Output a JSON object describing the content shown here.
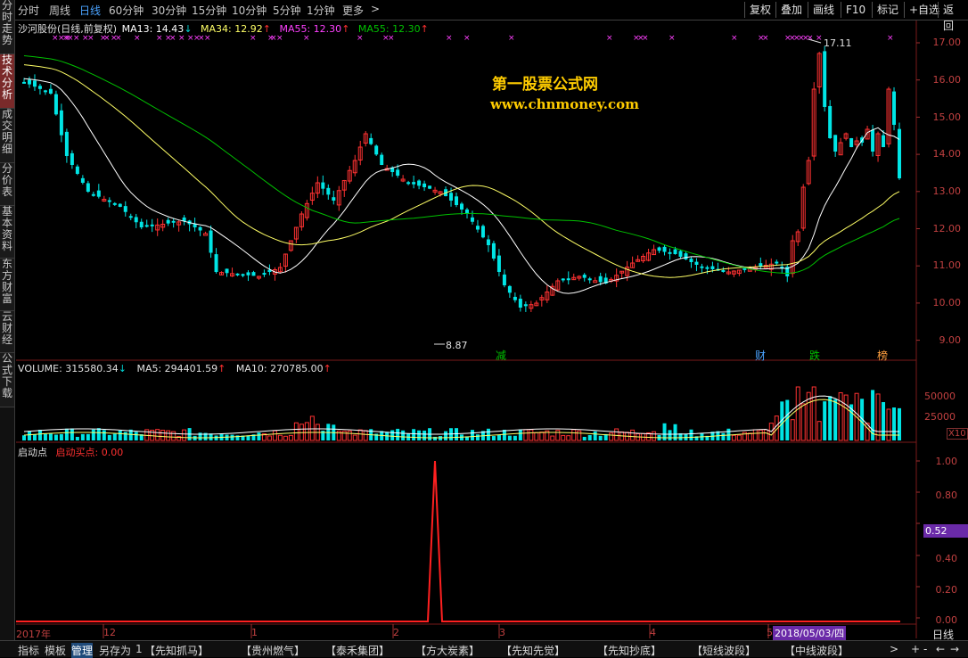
{
  "toolbar": {
    "periods": [
      "分时",
      "周线",
      "日线",
      "60分钟",
      "30分钟",
      "15分钟",
      "10分钟",
      "5分钟",
      "1分钟",
      "更多"
    ],
    "active_period": "日线",
    "more_arrow": ">",
    "right_buttons": [
      "复权",
      "叠加",
      "画线",
      "F10",
      "标记",
      "+自选",
      "返回"
    ]
  },
  "left_tabs": [
    "分时走势",
    "技术分析",
    "成交明细",
    "分价表",
    "基本资料",
    "东方财富",
    "云财经",
    "公式下载"
  ],
  "active_left_tab": "技术分析",
  "price_panel": {
    "title": "沙河股份(日线,前复权)",
    "ma13": "MA13: 14.43",
    "ma34": "MA34: 12.92",
    "ma55a": "MA55: 12.30",
    "ma55b": "MA55: 12.30",
    "ma13_dir": "↓",
    "ma34_dir": "↑",
    "ma55a_dir": "↑",
    "ma55b_dir": "↑",
    "watermark_title": "第一股票公式网",
    "watermark_url": "www.chnmoney.com",
    "high_label": "17.11",
    "low_label": "8.87",
    "y_ticks": [
      "17.00",
      "16.00",
      "15.00",
      "14.00",
      "13.00",
      "12.00",
      "11.00",
      "10.00",
      "9.00"
    ],
    "event_badges": [
      "减",
      "财",
      "跌",
      "榜"
    ]
  },
  "volume_panel": {
    "volume": "VOLUME: 315580.34",
    "ma5": "MA5: 294401.59",
    "ma10": "MA10: 270785.00",
    "volume_dir": "↓",
    "ma5_dir": "↑",
    "ma10_dir": "↑",
    "y_ticks": [
      "50000",
      "25000"
    ],
    "unit": "X10"
  },
  "indicator_panel": {
    "name": "启动点",
    "series_label": "启动买点: 0.00",
    "y_ticks": [
      "1.00",
      "0.80",
      "0.60",
      "0.40",
      "0.20",
      "0.00"
    ],
    "cursor_value": "0.52"
  },
  "time_axis": {
    "labels": [
      "2017年",
      "12",
      "1",
      "2",
      "3",
      "4",
      "5"
    ],
    "cursor_date": "2018/05/03/四",
    "period_label": "日线"
  },
  "bottom_bar": {
    "tabs": [
      "指标",
      "模板",
      "管理",
      "另存为"
    ],
    "active_tab": "管理",
    "page_num": "1",
    "formulas": [
      "【先知抓马】",
      "【贵州燃气】",
      "【泰禾集团】",
      "【方大炭素】",
      "【先知先觉】",
      "【先知抄底】",
      "【短线波段】",
      "【中线波段】"
    ],
    "scroll_right": ">",
    "zoom_in": "+",
    "zoom_out": "-",
    "nav_left": "←",
    "nav_right": "→"
  },
  "colors": {
    "up": "#ff3232",
    "down": "#00e5e5",
    "ma13": "#ffffff",
    "ma34": "#ffff66",
    "ma55": "#00c000",
    "ma55_label": "#ff40ff",
    "watermark": "#ffcc00",
    "indicator": "#ff2020"
  }
}
